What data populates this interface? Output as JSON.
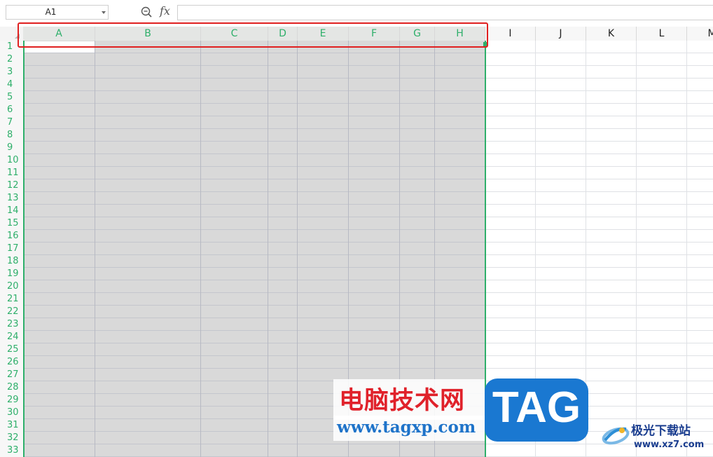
{
  "formula_bar": {
    "name_box": "A1",
    "fx_label": "fx"
  },
  "columns": [
    "A",
    "B",
    "C",
    "D",
    "E",
    "F",
    "G",
    "H",
    "I",
    "J",
    "K",
    "L",
    "M"
  ],
  "selected_columns": [
    "A",
    "B",
    "C",
    "D",
    "E",
    "F",
    "G",
    "H"
  ],
  "rows": [
    "1",
    "2",
    "3",
    "4",
    "5",
    "6",
    "7",
    "8",
    "9",
    "10",
    "11",
    "12",
    "13",
    "14",
    "15",
    "16",
    "17",
    "18",
    "19",
    "20",
    "21",
    "22",
    "23",
    "24",
    "25",
    "26",
    "27",
    "28",
    "29",
    "30",
    "31",
    "32",
    "33"
  ],
  "colors": {
    "accent": "#2eaf6a",
    "selection_fill": "#d9d9d9",
    "highlight": "#e02020"
  },
  "watermark": {
    "cn_text": "电脑技术网",
    "url": "www.tagxp.com",
    "tag": "TAG",
    "site_name": "极光下载站",
    "site_url": "www.xz7.com"
  }
}
